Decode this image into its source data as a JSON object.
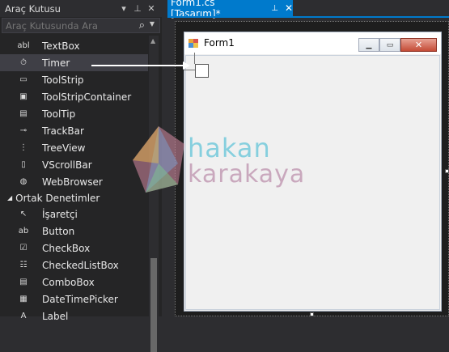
{
  "toolbox": {
    "title": "Araç Kutusu",
    "search_placeholder": "Araç Kutusunda Ara",
    "items_top": [
      {
        "label": "TextBox",
        "icon": "textbox-icon",
        "glyph": "abl"
      },
      {
        "label": "Timer",
        "icon": "timer-icon",
        "glyph": "⏱"
      },
      {
        "label": "ToolStrip",
        "icon": "toolstrip-icon",
        "glyph": "▭"
      },
      {
        "label": "ToolStripContainer",
        "icon": "toolstripcontainer-icon",
        "glyph": "▣"
      },
      {
        "label": "ToolTip",
        "icon": "tooltip-icon",
        "glyph": "▤"
      },
      {
        "label": "TrackBar",
        "icon": "trackbar-icon",
        "glyph": "⊸"
      },
      {
        "label": "TreeView",
        "icon": "treeview-icon",
        "glyph": "⋮"
      },
      {
        "label": "VScrollBar",
        "icon": "vscrollbar-icon",
        "glyph": "▯"
      },
      {
        "label": "WebBrowser",
        "icon": "webbrowser-icon",
        "glyph": "◍"
      }
    ],
    "category": "Ortak Denetimler",
    "items_bottom": [
      {
        "label": "İşaretçi",
        "icon": "pointer-icon",
        "glyph": "↖"
      },
      {
        "label": "Button",
        "icon": "button-icon",
        "glyph": "ab"
      },
      {
        "label": "CheckBox",
        "icon": "checkbox-icon",
        "glyph": "☑"
      },
      {
        "label": "CheckedListBox",
        "icon": "checkedlistbox-icon",
        "glyph": "☷"
      },
      {
        "label": "ComboBox",
        "icon": "combobox-icon",
        "glyph": "▤"
      },
      {
        "label": "DateTimePicker",
        "icon": "datetimepicker-icon",
        "glyph": "▦"
      },
      {
        "label": "Label",
        "icon": "label-icon",
        "glyph": "A"
      }
    ]
  },
  "document": {
    "tab_label": "Form1.cs [Tasarım]*",
    "form_title": "Form1"
  },
  "watermark": {
    "line1": "hakan",
    "line2": "karakaya"
  },
  "colors": {
    "accent": "#007acc",
    "panel": "#252526",
    "selected": "#3f3f46"
  }
}
